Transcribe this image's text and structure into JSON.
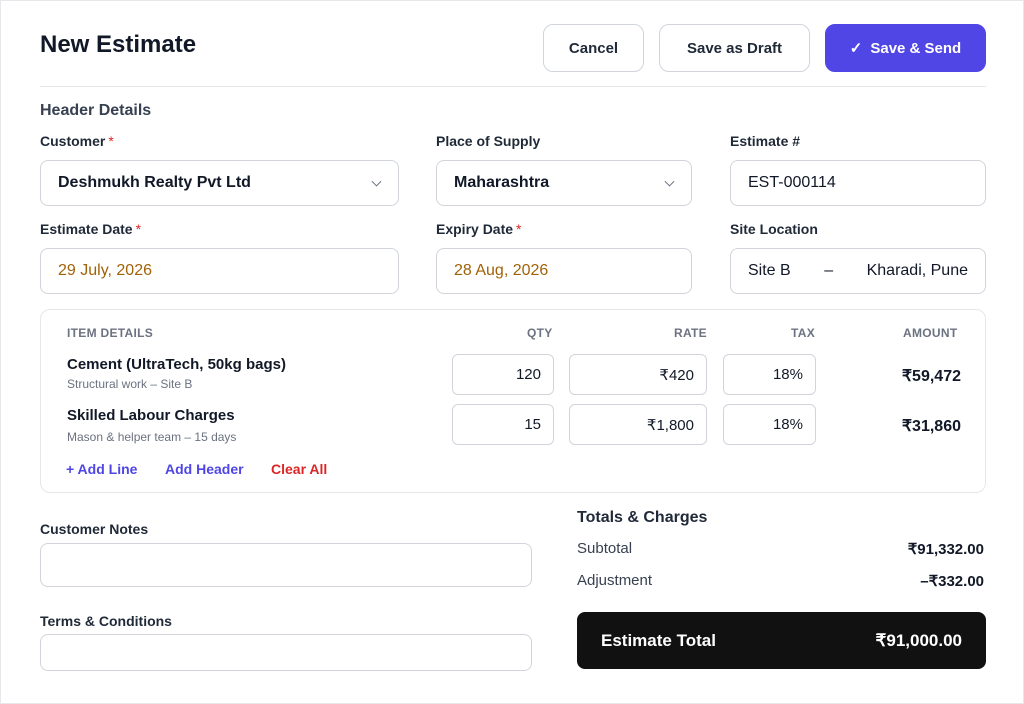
{
  "page": {
    "title": "New Estimate",
    "actions": {
      "cancel": "Cancel",
      "draft": "Save as Draft",
      "send": "Save & Send",
      "send_icon": "check-icon"
    }
  },
  "header": {
    "section_title": "Header Details",
    "customer": {
      "label": "Customer",
      "required": "*",
      "value": "Deshmukh Realty Pvt Ltd"
    },
    "place_of_supply": {
      "label": "Place of Supply",
      "value": "Maharashtra"
    },
    "estimate_number": {
      "label": "Estimate #",
      "value": "EST-000114"
    },
    "estimate_date": {
      "label": "Estimate Date",
      "required": "*",
      "value": "29 July, 2026"
    },
    "expiry_date": {
      "label": "Expiry Date",
      "required": "*",
      "value": "28 Aug, 2026"
    },
    "site_location": {
      "label": "Site Location",
      "site": "Site B",
      "separator": "–",
      "area": "Kharadi, Pune"
    }
  },
  "items": {
    "columns": {
      "details": "ITEM DETAILS",
      "qty": "QTY",
      "rate": "RATE",
      "tax": "TAX",
      "amount": "AMOUNT"
    },
    "rows": [
      {
        "name": "Cement (UltraTech, 50kg bags)",
        "desc": "Structural work – Site B",
        "qty": "120",
        "rate": "₹420",
        "tax": "18%",
        "amount": "₹59,472"
      },
      {
        "name": "Skilled Labour Charges",
        "desc": "Mason & helper team – 15 days",
        "qty": "15",
        "rate": "₹1,800",
        "tax": "18%",
        "amount": "₹31,860"
      }
    ],
    "actions": {
      "add_line": "+ Add Line",
      "add_header": "Add Header",
      "clear_all": "Clear All"
    }
  },
  "notes": {
    "customer_notes_label": "Customer Notes",
    "terms_label": "Terms & Conditions"
  },
  "totals": {
    "title": "Totals & Charges",
    "subtotal_label": "Subtotal",
    "subtotal_value": "₹91,332.00",
    "adjustment_label": "Adjustment",
    "adjustment_value": "–₹332.00",
    "grand_label": "Estimate Total",
    "grand_value": "₹91,000.00"
  },
  "colors": {
    "primary": "#4f46e5",
    "required": "#dc2626",
    "date_text": "#a16207",
    "clear": "#dc2626",
    "grand_bg": "#111111"
  }
}
